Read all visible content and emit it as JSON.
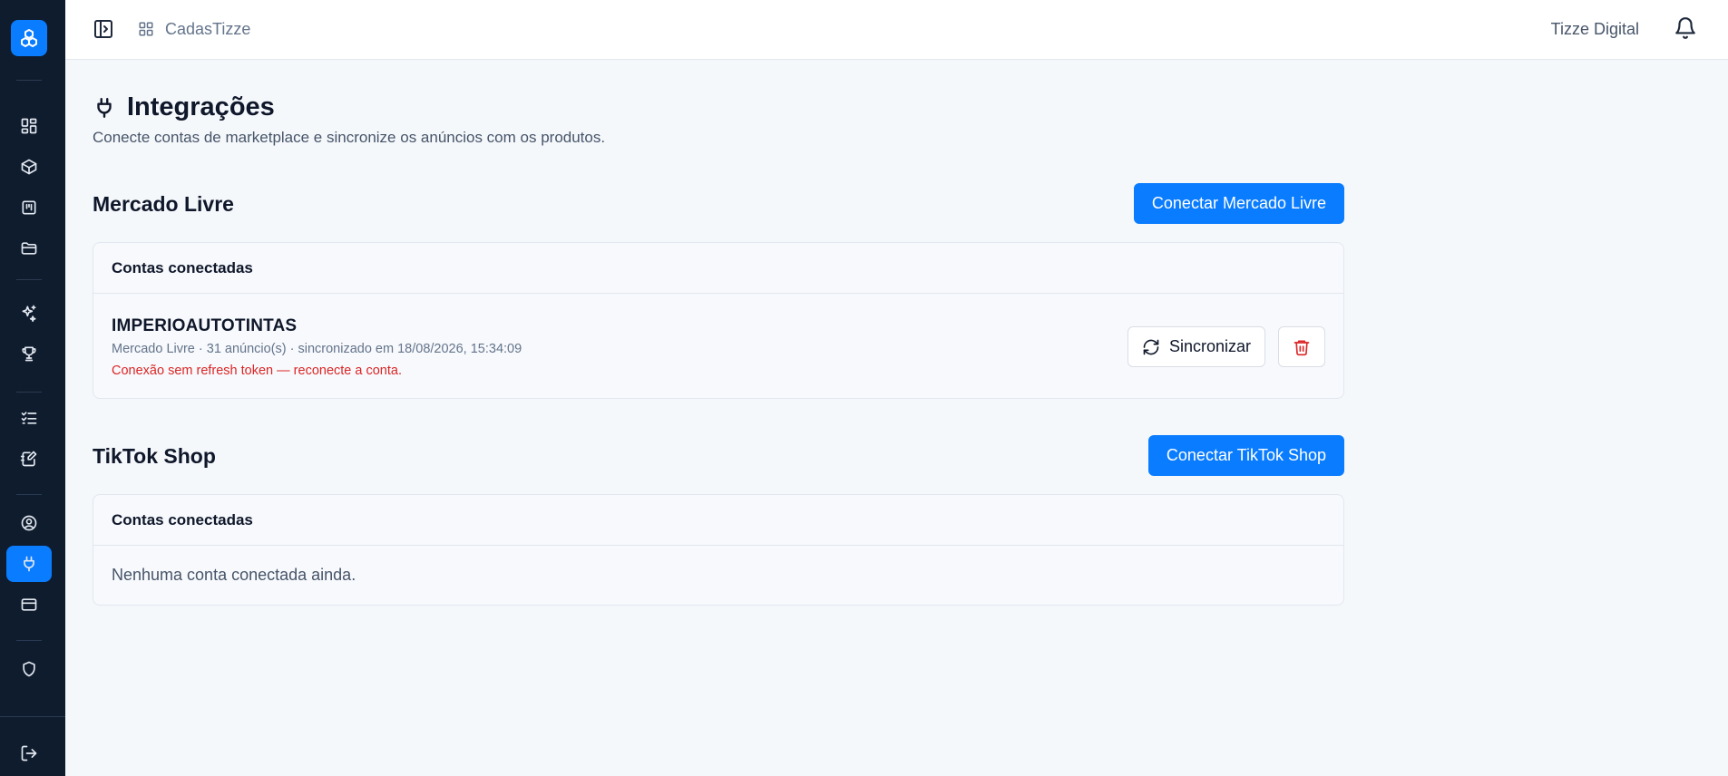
{
  "header": {
    "brand": "CadasTizze",
    "org": "Tizze Digital"
  },
  "sidebar": {
    "items": [
      {
        "icon": "dashboard-icon"
      },
      {
        "icon": "package-icon"
      },
      {
        "icon": "kanban-icon"
      },
      {
        "icon": "folder-icon"
      },
      {
        "icon": "sparkles-icon"
      },
      {
        "icon": "trophy-icon"
      },
      {
        "icon": "list-checks-icon"
      },
      {
        "icon": "notebook-pen-icon"
      },
      {
        "icon": "user-circle-icon"
      },
      {
        "icon": "plug-icon",
        "active": true
      },
      {
        "icon": "credit-card-icon"
      },
      {
        "icon": "shield-icon"
      },
      {
        "icon": "logout-icon"
      }
    ]
  },
  "page": {
    "title": "Integrações",
    "subtitle": "Conecte contas de marketplace e sincronize os anúncios com os produtos."
  },
  "sections": {
    "mercado": {
      "title": "Mercado Livre",
      "connect_label": "Conectar Mercado Livre",
      "card_title": "Contas conectadas",
      "account": {
        "name": "IMPERIOAUTOTINTAS",
        "meta": "Mercado Livre · 31 anúncio(s) · sincronizado em 18/08/2026, 15:34:09",
        "warning": "Conexão sem refresh token — reconecte a conta.",
        "sync_label": "Sincronizar"
      }
    },
    "tiktok": {
      "title": "TikTok Shop",
      "connect_label": "Conectar TikTok Shop",
      "card_title": "Contas conectadas",
      "empty": "Nenhuma conta conectada ainda."
    }
  },
  "colors": {
    "accent": "#0a7cff",
    "sidebar": "#0f1c2e",
    "danger": "#dc2626"
  }
}
